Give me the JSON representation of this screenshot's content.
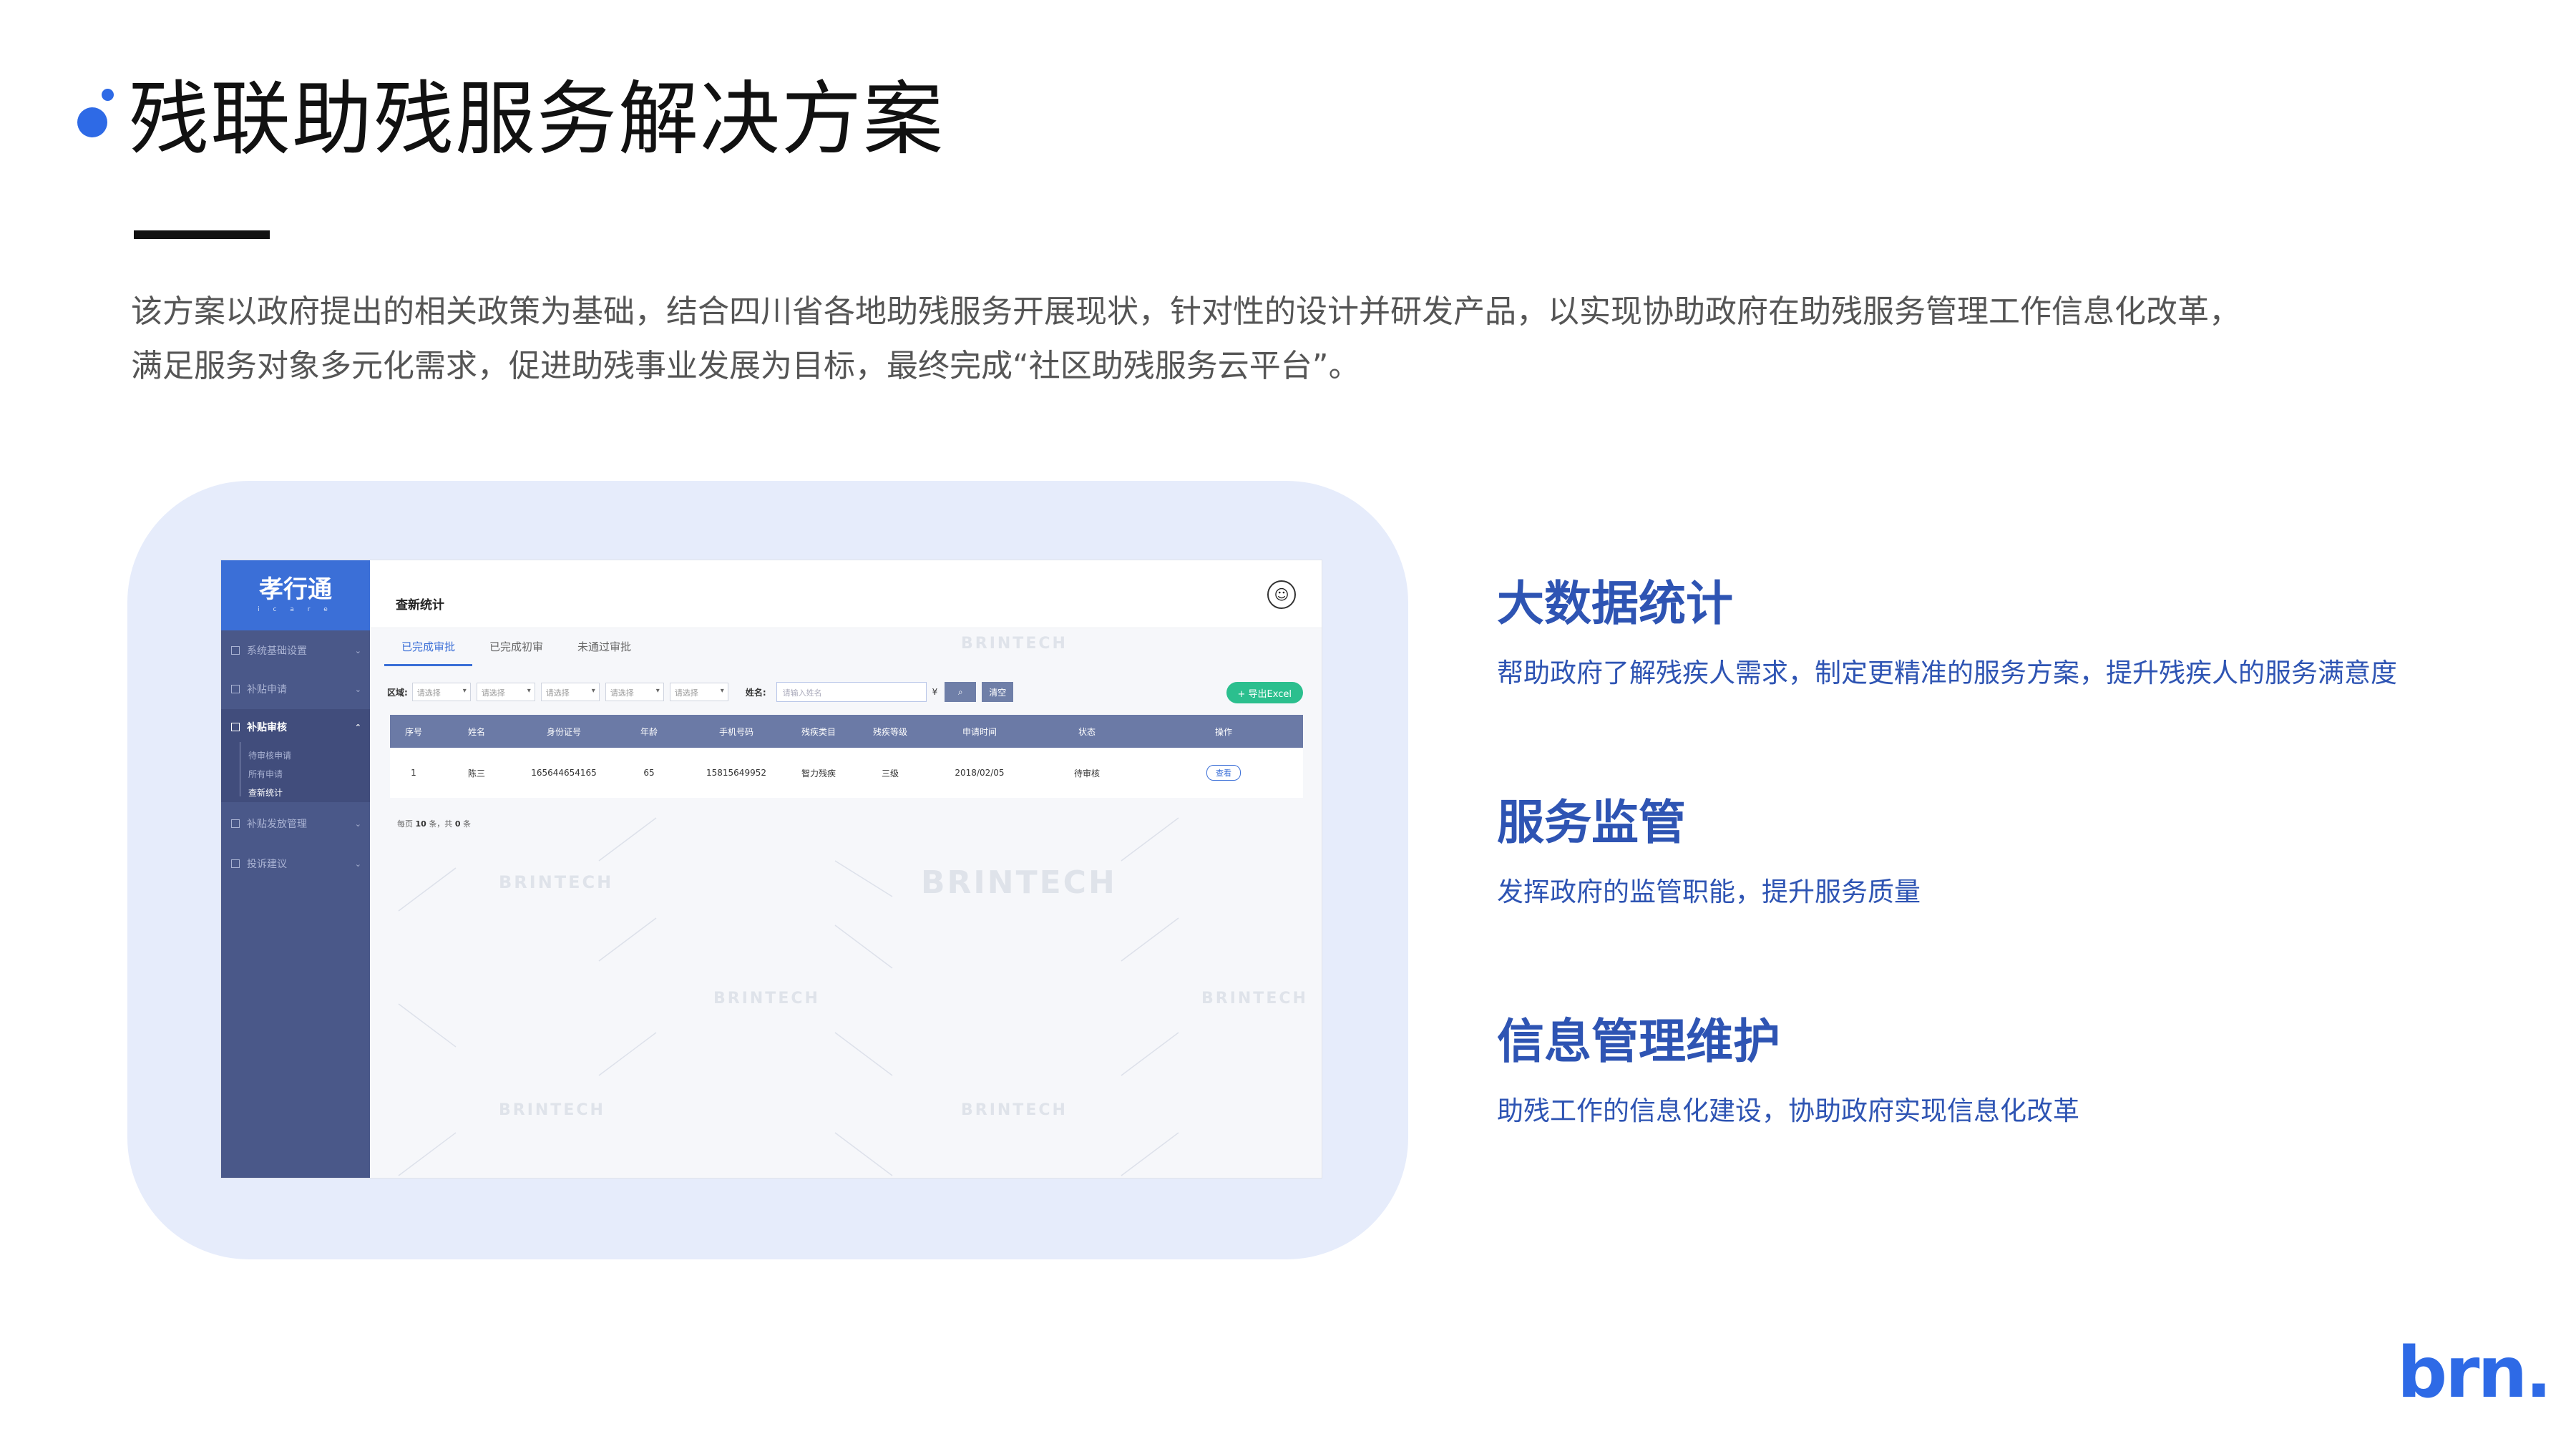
{
  "slide": {
    "title": "残联助残服务解决方案",
    "intro_line1": "该方案以政府提出的相关政策为基础，结合四川省各地助残服务开展现状，针对性的设计并研发产品，以实现协助政府在助残服务管理工作信息化改革，",
    "intro_line2": "满足服务对象多元化需求，促进助残事业发展为目标，最终完成“社区助残服务云平台”。",
    "brand_logo": "brn."
  },
  "colors": {
    "accent": "#2e6ae6",
    "feature_text": "#2e54b3",
    "card_bg": "#e6ecfb",
    "sidebar": "#4a5889",
    "table_header": "#6b7aa6",
    "export_button": "#2bbf8e"
  },
  "screenshot": {
    "logo_main": "孝行通",
    "logo_sub": "i c a r e",
    "sidebar": {
      "items": [
        {
          "label": "系统基础设置"
        },
        {
          "label": "补贴申请"
        },
        {
          "label": "补贴审核"
        },
        {
          "label": "补贴发放管理"
        },
        {
          "label": "投诉建议"
        }
      ],
      "subitems": [
        {
          "label": "待审核申请"
        },
        {
          "label": "所有申请"
        },
        {
          "label": "查新统计"
        }
      ]
    },
    "header_title": "查新统计",
    "avatar_icon": "user-avatar-icon",
    "tabs": [
      {
        "label": "已完成审批"
      },
      {
        "label": "已完成初审"
      },
      {
        "label": "未通过审批"
      }
    ],
    "filters": {
      "region_label": "区域:",
      "select_placeholder": "请选择",
      "name_label": "姓名:",
      "name_placeholder": "请输入姓名",
      "currency_symbol": "¥",
      "clear_label": "清空"
    },
    "export_label": "+ 导出Excel",
    "table": {
      "headers": [
        "序号",
        "姓名",
        "身份证号",
        "年龄",
        "手机号码",
        "残疾类目",
        "残疾等级",
        "申请时间",
        "状态",
        "操作"
      ],
      "rows": [
        [
          "1",
          "陈三",
          "165644654165",
          "65",
          "15815649952",
          "智力残疾",
          "三级",
          "2018/02/05",
          "待审核",
          "查看"
        ]
      ]
    },
    "pager": {
      "prefix": "每页",
      "per_page": "10",
      "mid": "条，共",
      "total": "0",
      "suffix": "条"
    },
    "watermark": "BRINTECH"
  },
  "features": [
    {
      "title": "大数据统计",
      "desc": "帮助政府了解残疾人需求，制定更精准的服务方案，提升残疾人的服务满意度"
    },
    {
      "title": "服务监管",
      "desc": "发挥政府的监管职能，提升服务质量"
    },
    {
      "title": "信息管理维护",
      "desc": "助残工作的信息化建设，协助政府实现信息化改革"
    }
  ]
}
